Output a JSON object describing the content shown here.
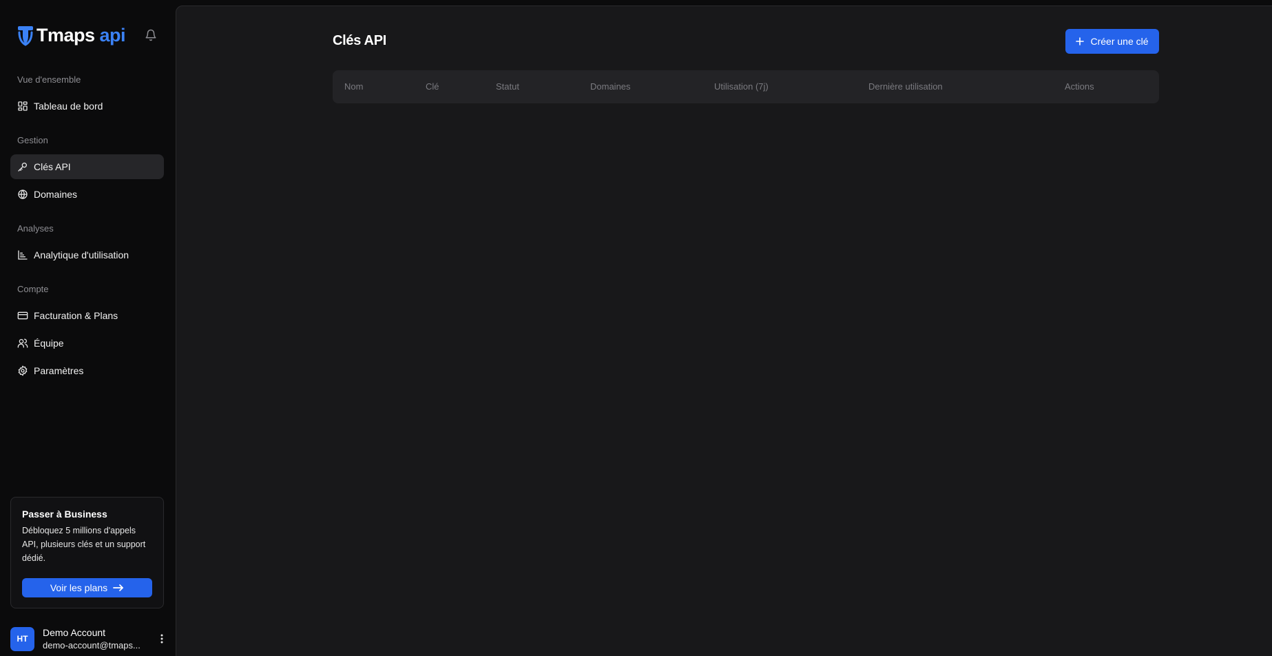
{
  "brand": {
    "word": "Tmaps",
    "accent": "api",
    "accent_color": "#3b82f6"
  },
  "colors": {
    "primary": "#2563eb",
    "active_bg": "#262629",
    "main_bg": "#18181a"
  },
  "sidebar": {
    "sections": [
      {
        "label": "Vue d'ensemble",
        "items": [
          {
            "label": "Tableau de bord",
            "icon": "dashboard-icon",
            "active": false
          }
        ]
      },
      {
        "label": "Gestion",
        "items": [
          {
            "label": "Clés API",
            "icon": "key-icon",
            "active": true
          },
          {
            "label": "Domaines",
            "icon": "globe-icon",
            "active": false
          }
        ]
      },
      {
        "label": "Analyses",
        "items": [
          {
            "label": "Analytique d'utilisation",
            "icon": "chart-icon",
            "active": false
          }
        ]
      },
      {
        "label": "Compte",
        "items": [
          {
            "label": "Facturation & Plans",
            "icon": "credit-card-icon",
            "active": false
          },
          {
            "label": "Équipe",
            "icon": "users-icon",
            "active": false
          },
          {
            "label": "Paramètres",
            "icon": "gear-icon",
            "active": false
          }
        ]
      }
    ],
    "upgrade": {
      "title": "Passer à Business",
      "description": "Débloquez 5 millions d'appels API, plusieurs clés et un support dédié.",
      "button_label": "Voir les plans"
    },
    "user": {
      "initials": "HT",
      "name": "Demo Account",
      "email": "demo-account@tmaps..."
    }
  },
  "main": {
    "title": "Clés API",
    "create_button_label": "Créer une clé",
    "table": {
      "columns": [
        "Nom",
        "Clé",
        "Statut",
        "Domaines",
        "Utilisation (7j)",
        "Dernière utilisation",
        "Actions"
      ],
      "rows": []
    }
  }
}
